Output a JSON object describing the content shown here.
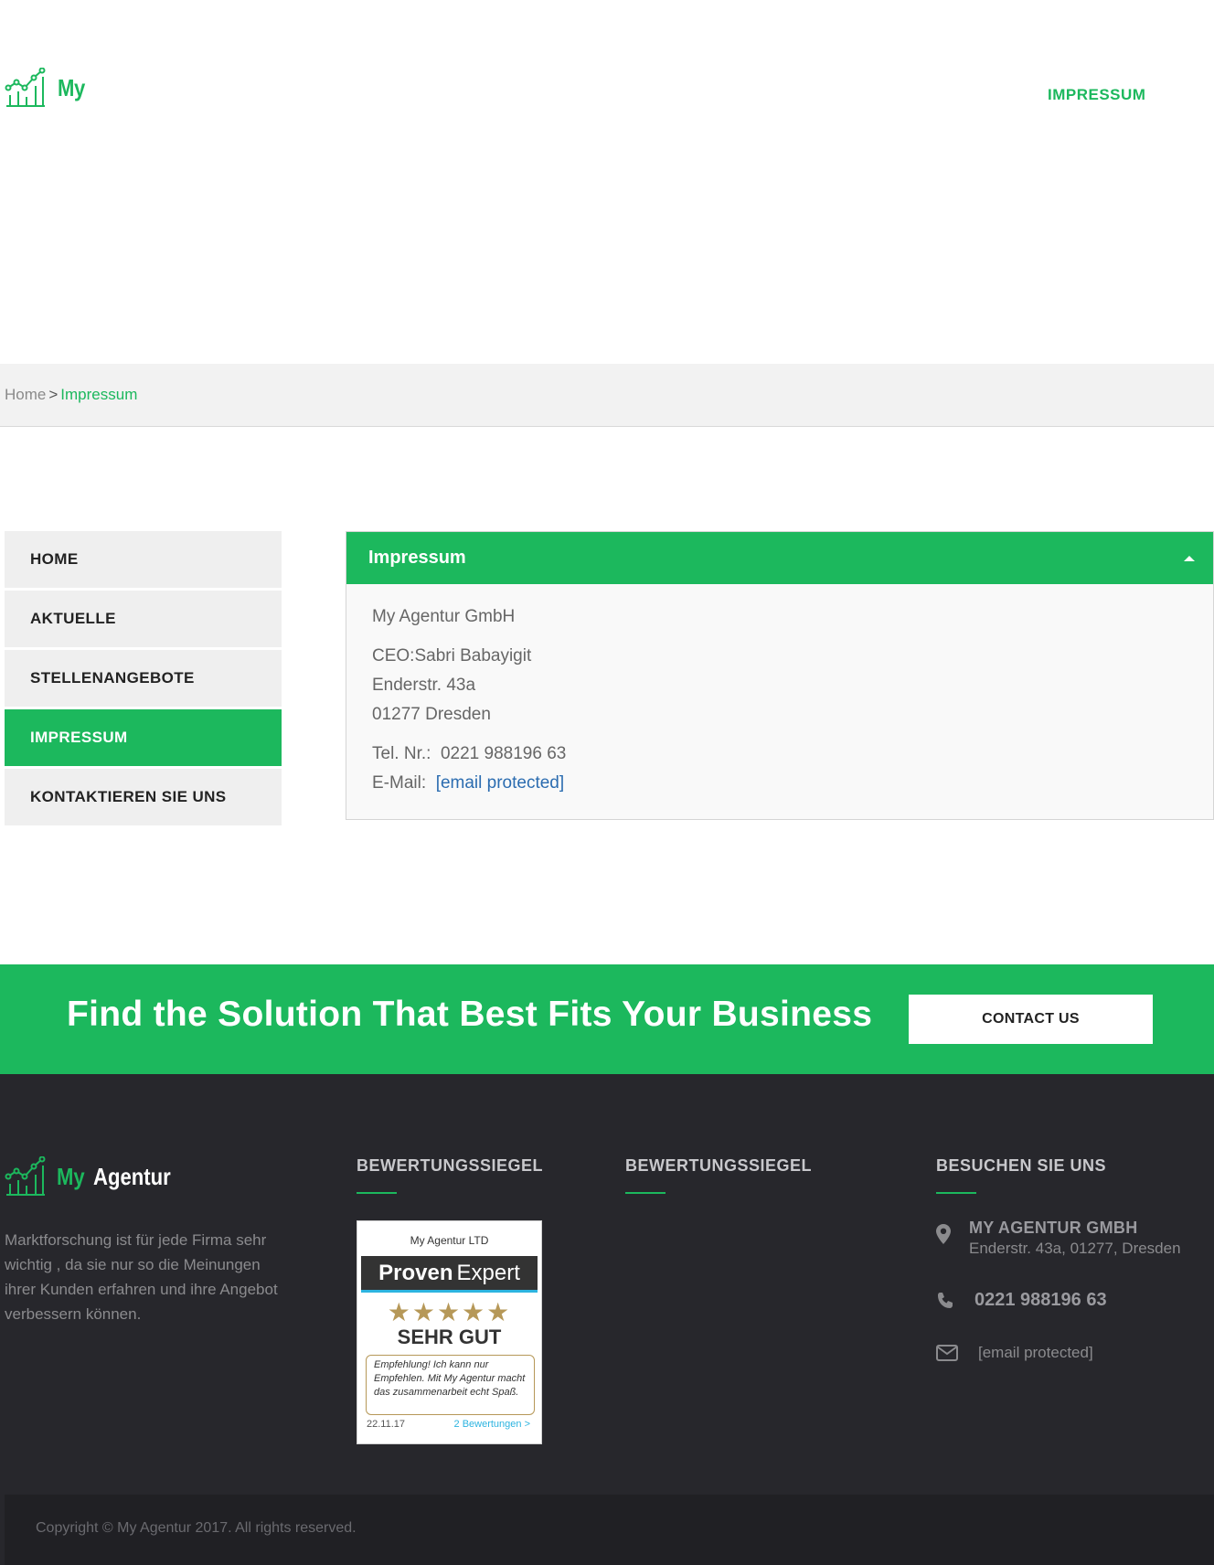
{
  "header": {
    "logo_text": "My",
    "nav": {
      "impressum": "IMPRESSUM"
    }
  },
  "breadcrumb": {
    "home": "Home",
    "separator": ">",
    "current": "Impressum"
  },
  "sidebar": {
    "items": [
      {
        "label": "HOME",
        "active": false
      },
      {
        "label": "AKTUELLE",
        "active": false
      },
      {
        "label": "STELLENANGEBOTE",
        "active": false
      },
      {
        "label": "IMPRESSUM",
        "active": true
      },
      {
        "label": "KONTAKTIEREN SIE UNS",
        "active": false
      }
    ]
  },
  "panel": {
    "title": "Impressum",
    "company": "My Agentur GmbH",
    "ceo": "CEO:Sabri Babayigit",
    "street": "Enderstr. 43a",
    "city": "01277 Dresden",
    "tel_label": "Tel. Nr.:",
    "tel_value": "0221 988196 63",
    "email_label": "E-Mail:",
    "email_value": "[email protected]"
  },
  "cta": {
    "text": "Find the Solution That Best Fits Your Business",
    "button": "CONTACT US"
  },
  "footer": {
    "logo_my": "My",
    "logo_agentur": "Agentur",
    "about": "Marktforschung ist für jede Firma sehr wichtig , da sie nur so die Meinungen ihrer Kunden erfahren und ihre Angebot verbessern können.",
    "col2_heading": "BEWERTUNGSSIEGEL",
    "col3_heading": "BEWERTUNGSSIEGEL",
    "col4_heading": "BESUCHEN SIE UNS",
    "badge": {
      "company": "My Agentur LTD",
      "brand_bold": "Proven",
      "brand_light": "Expert",
      "stars": "★★★★★",
      "grade": "SEHR GUT",
      "quote": "Empfehlung! Ich kann nur Empfehlen. Mit My Agentur macht das zusammenarbeit echt Spaß.",
      "date": "22.11.17",
      "reviews": "2 Bewertungen >"
    },
    "contact": {
      "name": "MY AGENTUR GMBH",
      "address": "Enderstr. 43a, 01277, Dresden",
      "phone": "0221 988196 63",
      "email": "[email protected]"
    },
    "copyright": "Copyright © My Agentur 2017. All rights reserved."
  },
  "colors": {
    "accent": "#1cb85d",
    "footer_bg": "#27272c",
    "copyright_bg": "#202024"
  }
}
